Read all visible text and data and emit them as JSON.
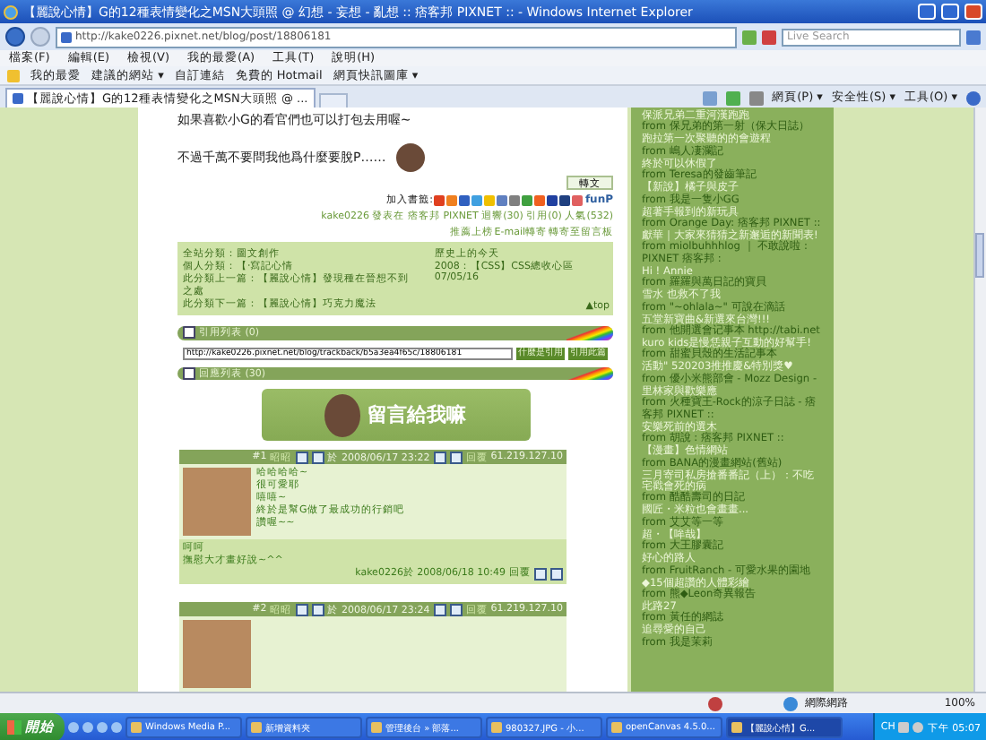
{
  "window": {
    "title": "【麗說心情】G的12種表情變化之MSN大頭照 @ 幻想 - 妄想 - 亂想 :: 痞客邦 PIXNET :: - Windows Internet Explorer"
  },
  "address_bar": {
    "url": "http://kake0226.pixnet.net/blog/post/18806181"
  },
  "search": {
    "placeholder": "Live Search"
  },
  "menu": [
    "檔案(F)",
    "編輯(E)",
    "檢視(V)",
    "我的最愛(A)",
    "工具(T)",
    "說明(H)"
  ],
  "favorites_bar": {
    "label": "我的最愛",
    "links": [
      "建議的網站 ▾",
      "自訂連結",
      "免費的 Hotmail",
      "網頁快訊圖庫 ▾"
    ]
  },
  "tabs": [
    {
      "label": "【麗說心情】G的12種表情變化之MSN大頭照 @ ...",
      "selected": true
    }
  ],
  "command_bar": [
    "網頁(P) ▾",
    "安全性(S) ▾",
    "工具(O) ▾"
  ],
  "post": {
    "lines": [
      "如果喜歡小G的看官們也可以打包去用喔~",
      "不過千萬不要問我他爲什麼要脫P……"
    ],
    "share_button": "轉文",
    "funp": "funP",
    "bookmark_label": "加入書籤:",
    "meta": "kake0226 發表在 痞客邦 PIXNET 迴響(30) 引用(0) 人氣(532)",
    "actions": [
      "推薦上榜",
      "E-mail轉寄",
      "轉寄至留言板"
    ],
    "info": {
      "left": [
        "全站分類：圖文創作",
        "個人分類：【‧寫記心情",
        "此分類上一篇：【麗說心情】發現種在晉想不到之處",
        "此分類下一篇：【麗說心情】巧克力魔法"
      ],
      "history_title": "歷史上的今天",
      "history": [
        "2008：【CSS】CSS總收心區07/05/16"
      ],
      "top": "▲top"
    },
    "trackback": {
      "title": "引用列表 (0)",
      "url": "http://kake0226.pixnet.net/blog/trackback/b5a3ea4f65c/18806181",
      "buttons": [
        "什麼是引用",
        "引用此篇"
      ]
    },
    "comments_bar": "回應列表 (30)",
    "banner": "留言給我嘛",
    "comments": [
      {
        "number": "#1",
        "author": "昭昭",
        "time": "於 2008/06/17 23:22",
        "reply": "回覆",
        "ip": "61.219.127.10",
        "body": [
          "哈哈哈哈~",
          "很可愛耶",
          "嘻嘻~",
          "終於是幫G做了最成功的行銷吧",
          "讚喔~~"
        ],
        "owner_reply": {
          "lines": [
            "呵呵",
            "撫慰大才畫好說~^^"
          ],
          "meta": "kake0226於 2008/06/18 10:49",
          "reply": "回覆"
        }
      },
      {
        "number": "#2",
        "author": "昭昭",
        "time": "於 2008/06/17 23:24",
        "reply": "回覆",
        "ip": "61.219.127.10"
      }
    ]
  },
  "sidebar": {
    "items": [
      {
        "title": "保派兄弟二重河漢跑跑",
        "source": "from 保兄弟的第一射（保大日誌）"
      },
      {
        "title": "跑拉第一次聚聽的的會遊程",
        "source": "from 嶋人凄瀾記"
      },
      {
        "title": "終於可以休假了",
        "source": "from Teresa的發齒筆記"
      },
      {
        "title": "【新說】橘子與皮子",
        "source": "from 我是一隻小GG"
      },
      {
        "title": "超著手報到的新玩具",
        "source": "from Orange Day: 痞客邦 PIXNET ::"
      },
      {
        "title": "獻華｜大家來猜猜之新邂逅的新聞表!",
        "source": "from miolbuhhhlog ｜ 不敢說啦 : PIXNET 痞客邦 :"
      },
      {
        "title": "Hi ! Annie",
        "source": "from 羅羅與萬日記的寶貝"
      },
      {
        "title": "雪水 也救不了我",
        "source": "from \"~ohlala~\" 可說在滴話"
      },
      {
        "title": "五堂新寶曲&新選來台灣!!!",
        "source": "from 他開選會记事本 http://tabi.net"
      },
      {
        "title": "kuro kids是慢恁親子互動的好幫手!",
        "source": "from 甜蜜貝殼的生活記事本"
      },
      {
        "title": "活動\" 520203推推慶&特別獎♥",
        "source": "from 優小米熊部會 - Mozz Design -"
      },
      {
        "title": "里林家與歡樂應",
        "source": "from 火種寶王-Rock的涼子日誌 - 痞客邦 PIXNET ::"
      },
      {
        "title": "安樂死前的選木",
        "source": "from 胡說 : 痞客邦 PIXNET ::"
      },
      {
        "title": "【漫畫】色情網站",
        "source": "from BANA的漫畫網站(舊站)"
      },
      {
        "title": "三月寄司私房搶番番記（上）：不吃宅戳會死的病",
        "source": "from 酷酷壽司的日記"
      },
      {
        "title": "國匠・米粒也會畫畫...",
        "source": "from 艾艾等一等"
      },
      {
        "title": "超・【哞哉】",
        "source": "from 大王膠囊記"
      },
      {
        "title": "好心的路人",
        "source": "from FruitRanch - 可愛水果的園地"
      },
      {
        "title": "◆15個超讚的人體彩繪",
        "source": "from 熊◆Leon奇異報告"
      },
      {
        "title": "此路27",
        "source": "from 黃任的網誌"
      },
      {
        "title": "追尋愛的自己",
        "source": "from 我是茉莉"
      }
    ]
  },
  "status_bar": {
    "zone": "網際網路",
    "zoom": "100%"
  },
  "taskbar": {
    "start": "開始",
    "tasks": [
      {
        "label": "Windows Media P...",
        "selected": false
      },
      {
        "label": "新增資料夾",
        "selected": false
      },
      {
        "label": "管理後台 » 部落...",
        "selected": false
      },
      {
        "label": "980327.JPG - 小...",
        "selected": false
      },
      {
        "label": "openCanvas 4.5.0...",
        "selected": false
      },
      {
        "label": "【麗說心情】G...",
        "selected": true
      }
    ],
    "tray": "CH",
    "clock": "下午 05:07"
  }
}
